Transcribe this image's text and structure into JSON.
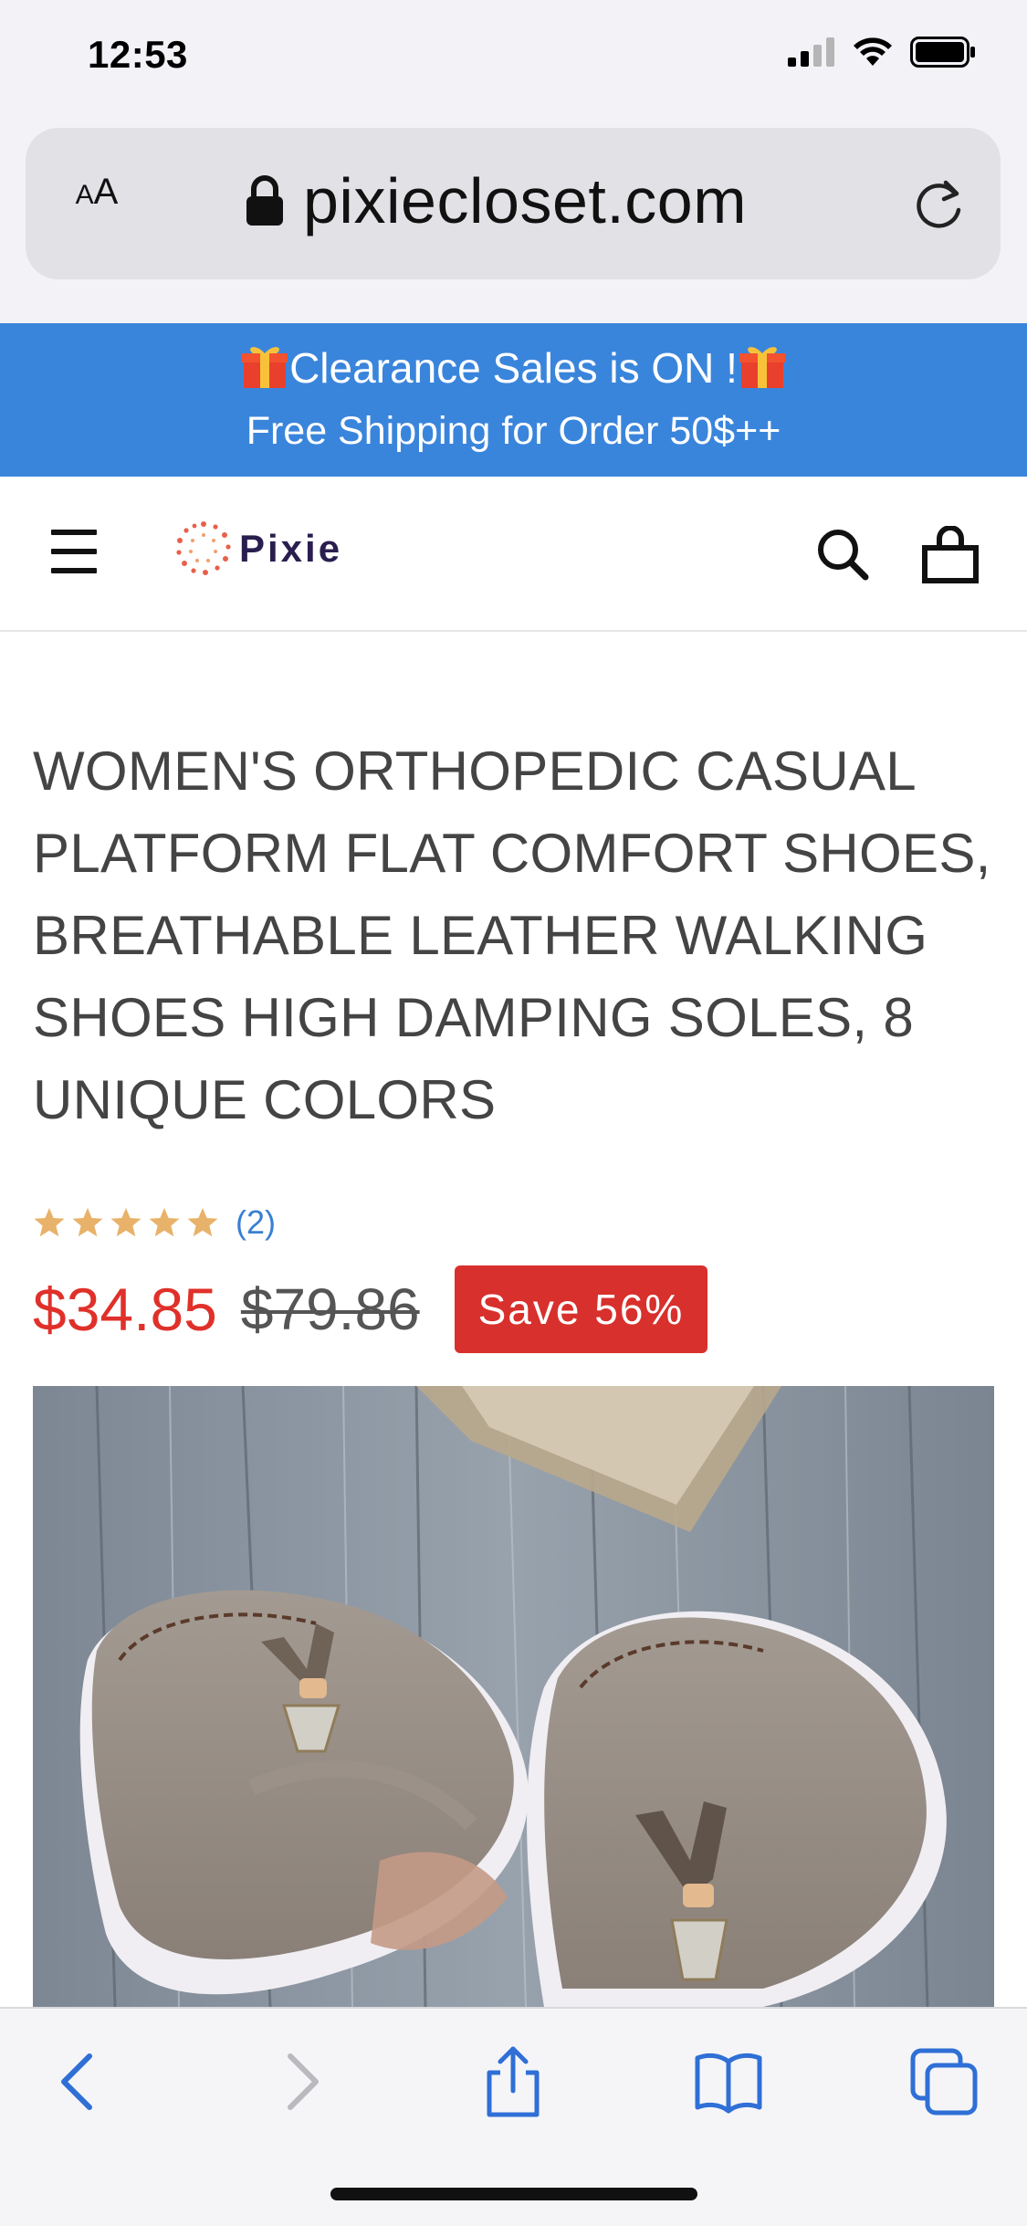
{
  "status_bar": {
    "time": "12:53",
    "icons": [
      "signal-icon",
      "wifi-icon",
      "battery-icon"
    ]
  },
  "browser": {
    "text_size_label_small": "A",
    "text_size_label_large": "A",
    "url": "pixiecloset.com",
    "lock_icon": "lock-icon",
    "reload_icon": "reload-icon"
  },
  "banner": {
    "line1": "Clearance Sales is ON !",
    "line2": "Free Shipping for Order 50$++",
    "gift_icon": "gift-icon",
    "color": "#3a85dc"
  },
  "header": {
    "logo_text": "Pixie",
    "menu_icon": "menu-icon",
    "search_icon": "search-icon",
    "bag_icon": "shopping-bag-icon"
  },
  "product": {
    "title": "WOMEN'S ORTHOPEDIC CASUAL PLATFORM FLAT COMFORT SHOES, BREATHABLE LEATHER WALKING SHOES HIGH DAMPING SOLES, 8 UNIQUE COLORS",
    "rating_stars": 5,
    "review_count": "(2)",
    "sale_price": "$34.85",
    "original_price": "$79.86",
    "save_badge": "Save 56%",
    "sale_color": "#e0302a",
    "badge_color": "#d8302c",
    "star_color": "#e8b26a",
    "image_subject": "grey suede platform shoes with tassels on wooden floor"
  },
  "toolbar": {
    "items": [
      "back-icon",
      "forward-icon",
      "share-icon",
      "bookmarks-icon",
      "tabs-icon"
    ]
  }
}
